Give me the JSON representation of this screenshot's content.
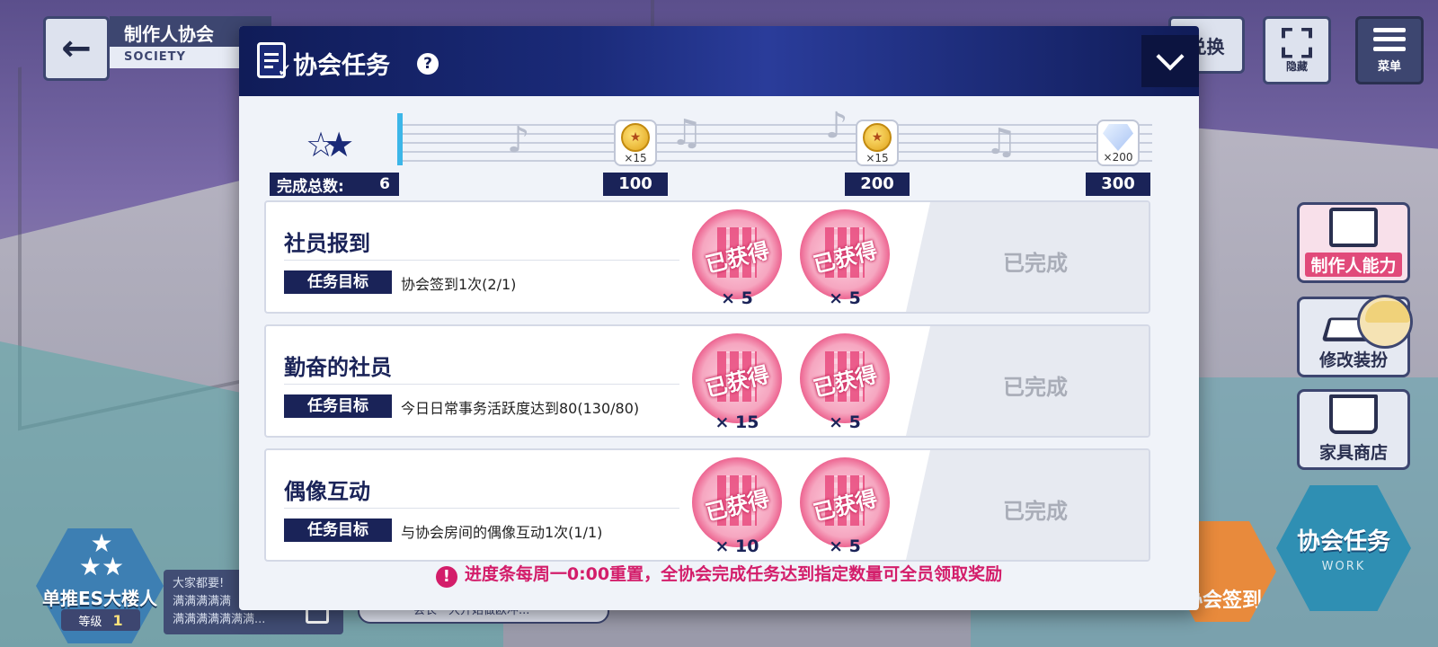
{
  "header": {
    "society_title": "制作人协会",
    "society_sub": "SOCIETY",
    "exchange_label": "兑换",
    "hide_label": "隐藏",
    "menu_label": "菜单"
  },
  "side_buttons": [
    {
      "label": "制作人能力"
    },
    {
      "label": "修改装扮"
    },
    {
      "label": "家具商店"
    }
  ],
  "bottom": {
    "task_hex_label": "协会任务",
    "task_hex_sub": "WORK",
    "sign_hex_label": "协会签到",
    "level_name": "单推ES大楼人",
    "level_label": "等级",
    "level_value": "1",
    "chat_line1": "大家都要!",
    "chat_line2": "满满满满满",
    "chat_line3": "满满满满满满满...",
    "chat_preview": "会长一大开始做欧冲..."
  },
  "modal": {
    "title": "协会任务",
    "help_icon": "?",
    "total_label": "完成总数:",
    "total_value": "6",
    "milestones": [
      {
        "count": "×15",
        "label": "100",
        "icon": "gold-coin-icon"
      },
      {
        "count": "×15",
        "label": "200",
        "icon": "gold-coin-icon"
      },
      {
        "count": "×200",
        "label": "300",
        "icon": "diamond-icon"
      }
    ],
    "tasks": [
      {
        "name": "社员报到",
        "goal_tag": "任务目标",
        "goal": "协会签到1次(2/1)",
        "stamp": "已获得",
        "rewards": [
          "× 5",
          "× 5"
        ],
        "status": "已完成"
      },
      {
        "name": "勤奋的社员",
        "goal_tag": "任务目标",
        "goal": "今日日常事务活跃度达到80(130/80)",
        "stamp": "已获得",
        "rewards": [
          "× 15",
          "× 5"
        ],
        "status": "已完成"
      },
      {
        "name": "偶像互动",
        "goal_tag": "任务目标",
        "goal": "与协会房间的偶像互动1次(1/1)",
        "stamp": "已获得",
        "rewards": [
          "× 10",
          "× 5"
        ],
        "status": "已完成"
      }
    ],
    "notice": "进度条每周一0:00重置，全协会完成任务达到指定数量可全员领取奖励"
  },
  "colors": {
    "navy": "#1a2358",
    "accent_pink": "#d31d6a",
    "progress_blue": "#3cb6e8"
  }
}
